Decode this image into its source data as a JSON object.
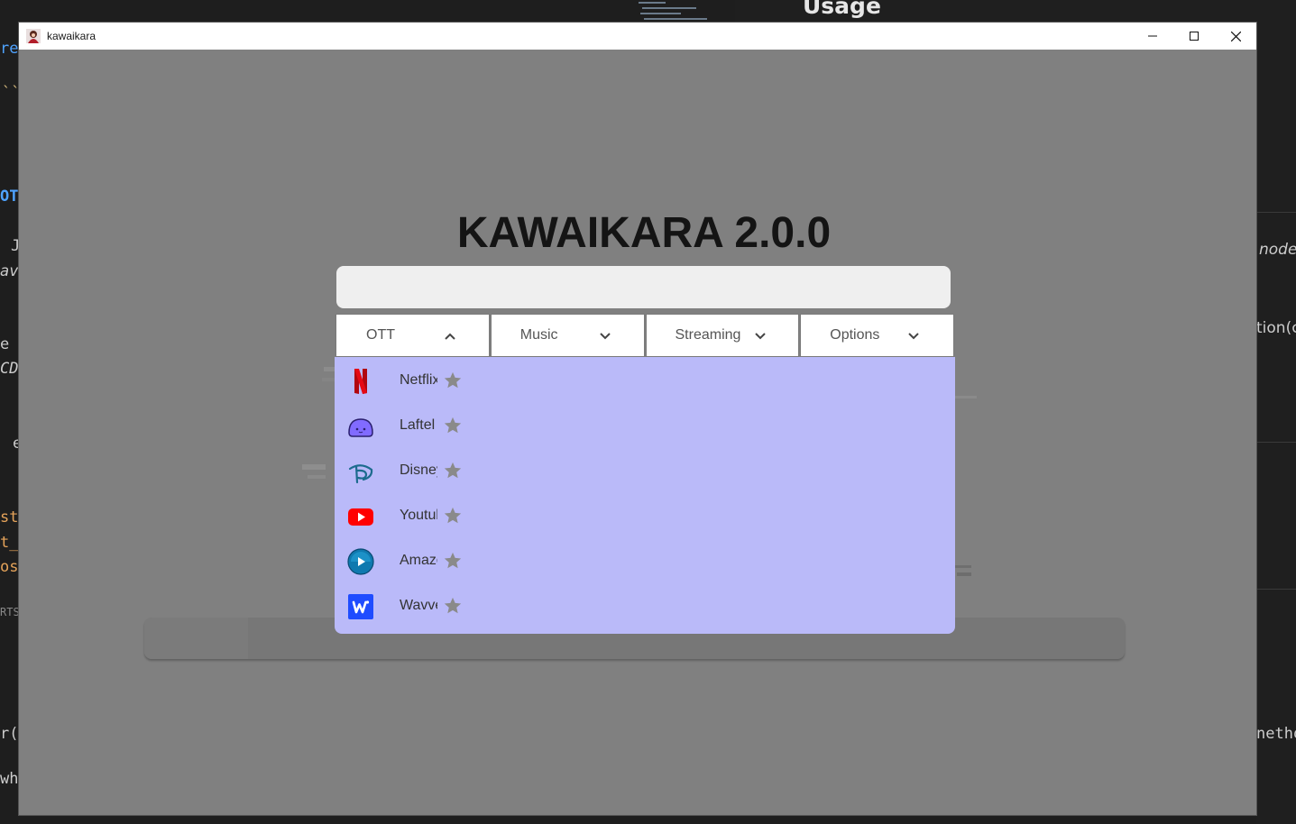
{
  "background": {
    "heading": "Usage",
    "left_fragments": [
      "rel",
      "``",
      "OTT",
      "J",
      "avr",
      "e n",
      "CDM",
      "e",
      "st_",
      "t_e",
      "os_",
      "RTS",
      "r(",
      "wh"
    ],
    "right_fragments": [
      "node",
      "tion(c",
      "netho"
    ]
  },
  "window": {
    "title": "kawaikara",
    "minimize_label": "Minimize",
    "maximize_label": "Maximize",
    "close_label": "Close"
  },
  "app": {
    "title": "KAWAIKARA 2.0.0",
    "search": {
      "value": "",
      "placeholder": ""
    },
    "tabs": [
      {
        "label": "OTT",
        "state": "expanded"
      },
      {
        "label": "Music",
        "state": "collapsed"
      },
      {
        "label": "Streaming",
        "state": "collapsed"
      },
      {
        "label": "Options",
        "state": "collapsed"
      }
    ],
    "ott_items": [
      {
        "label": "Netflix",
        "icon": "netflix-icon"
      },
      {
        "label": "Laftel",
        "icon": "laftel-icon"
      },
      {
        "label": "Disney+",
        "icon": "disney-plus-icon"
      },
      {
        "label": "Youtube",
        "icon": "youtube-icon"
      },
      {
        "label": "Amazon",
        "icon": "prime-video-icon"
      },
      {
        "label": "Wavve",
        "icon": "wavve-icon"
      }
    ]
  },
  "colors": {
    "overlay": "#808080",
    "dropdown_bg": "#babaf9",
    "star": "#8a8a8a",
    "netflix": "#d81f26",
    "laftel": "#816bff",
    "youtube": "#ff0000",
    "wavve": "#1f4cff"
  }
}
